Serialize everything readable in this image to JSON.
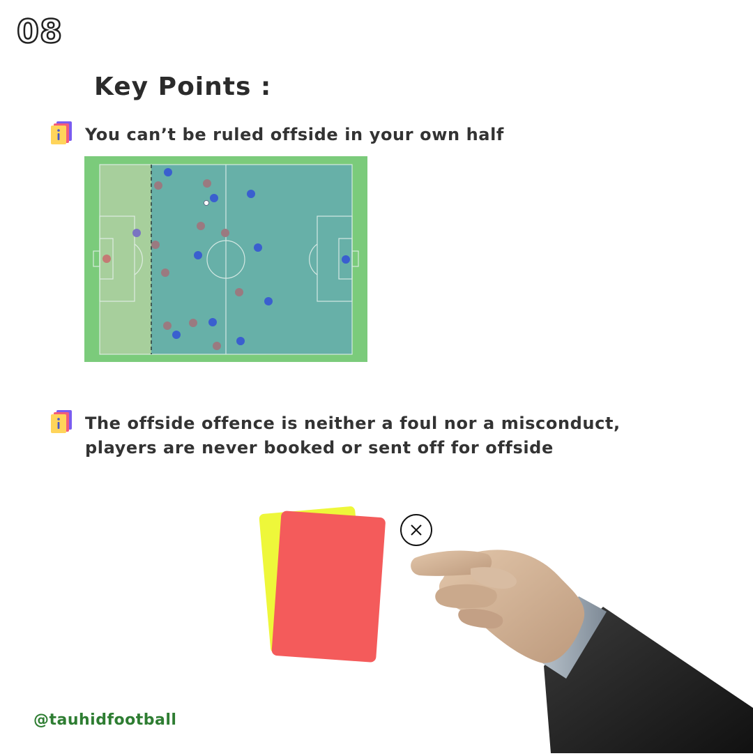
{
  "page_number": "08",
  "title": "Key Points :",
  "points": [
    {
      "icon": "info-card-icon",
      "text": "You can’t be ruled offside in your own half"
    },
    {
      "icon": "info-card-icon",
      "text_line1": "The offside offence is neither a foul nor a misconduct,",
      "text_line2": "players are never booked or sent off for offside"
    }
  ],
  "illustrations": {
    "pitch": "football-pitch-diagram",
    "cards": "yellow-and-red-cards",
    "cross": "close-circle-icon",
    "hand": "referee-hand-pointing"
  },
  "colors": {
    "pitch_green": "#7bcb7b",
    "attacking_half_overlay": "#5fa9a8",
    "team_blue": "#3a5fcf",
    "team_red": "#9a7a80",
    "yellow_card": "#eef73a",
    "red_card": "#f45b5b",
    "handle_green": "#2e7d32"
  },
  "footer": {
    "handle": "@tauhidfootball"
  }
}
